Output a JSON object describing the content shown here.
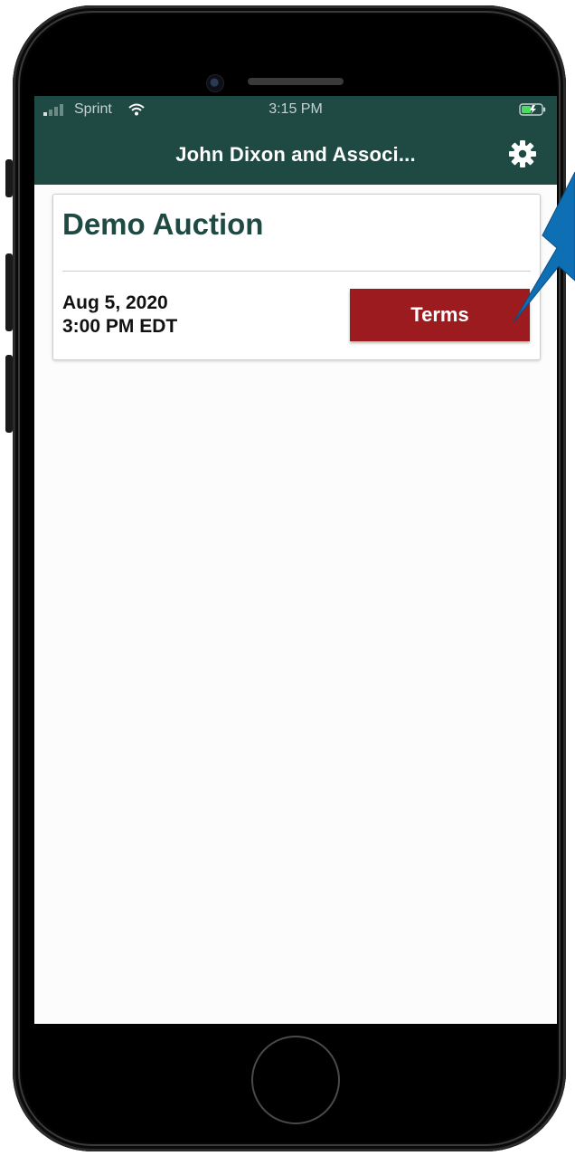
{
  "status_bar": {
    "carrier": "Sprint",
    "time": "3:15 PM"
  },
  "nav": {
    "title": "John Dixon and Associ..."
  },
  "auction": {
    "title": "Demo Auction",
    "date": "Aug 5, 2020",
    "time": "3:00 PM EDT",
    "terms_label": "Terms"
  },
  "colors": {
    "header": "#1f4a44",
    "terms_button": "#9b1b1f",
    "callout": "#0f6fb5"
  },
  "icons": [
    "signal-icon",
    "wifi-icon",
    "battery-icon",
    "gear-icon"
  ]
}
